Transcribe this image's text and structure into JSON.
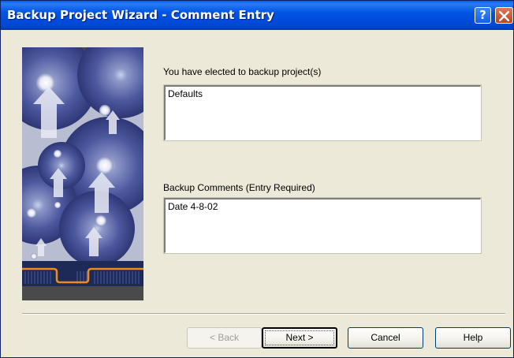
{
  "window": {
    "title": "Backup Project Wizard - Comment Entry",
    "help_glyph": "?",
    "close_icon": "close-icon"
  },
  "form": {
    "projects_label": "You have elected to backup project(s)",
    "projects_value": "Defaults",
    "comments_label": "Backup Comments  (Entry Required)",
    "comments_value": "Date 4-8-02"
  },
  "buttons": {
    "back": "< Back",
    "next": "Next >",
    "cancel": "Cancel",
    "help": "Help"
  },
  "colors": {
    "titlebar": "#0055e5",
    "close_button": "#c1401a",
    "dialog_bg": "#ece9d8",
    "accent_orange": "#f08a1c"
  }
}
